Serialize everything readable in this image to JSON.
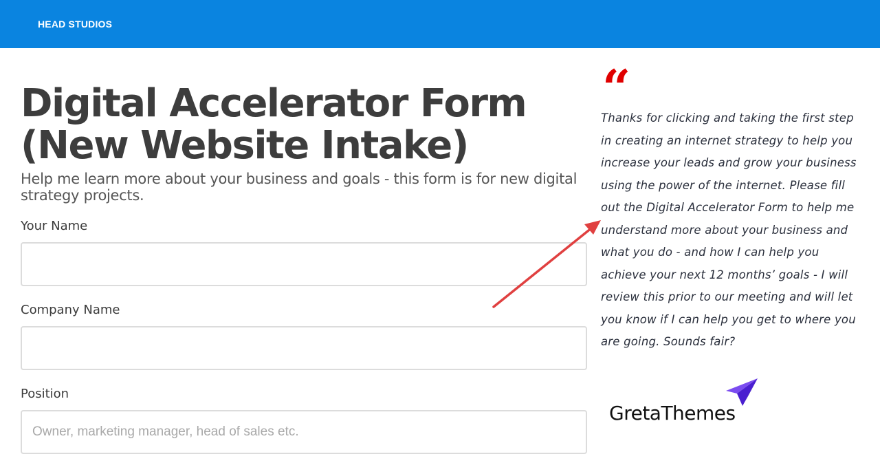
{
  "header": {
    "brand": "HEAD STUDIOS",
    "bg_color": "#0a84e0"
  },
  "main": {
    "title_line1": "Digital Accelerator Form",
    "title_line2": "(New Website Intake)",
    "subtitle": "Help me learn more about your business and goals - this form is for new digital strategy projects.",
    "fields": [
      {
        "label": "Your Name",
        "value": "",
        "placeholder": ""
      },
      {
        "label": "Company Name",
        "value": "",
        "placeholder": ""
      },
      {
        "label": "Position",
        "value": "",
        "placeholder": "Owner, marketing manager, head of sales etc."
      }
    ]
  },
  "aside": {
    "quote_mark": "“",
    "quote_color": "#e00000",
    "quote_text": "Thanks for clicking and taking the first step in creating an internet strategy to help you increase your leads and grow your business using the power of the internet. Please fill out the Digital Accelerator Form to help me understand more about your business and what you do - and how I can help you achieve your next 12 months’ goals - I will review this prior to our meeting and will let you know if I can help you get to where you are going. Sounds fair?",
    "arrow_color": "#e04040",
    "logo_text": "GretaThemes",
    "logo_icon": "paper-plane-icon",
    "logo_color": "#5a2be0"
  }
}
